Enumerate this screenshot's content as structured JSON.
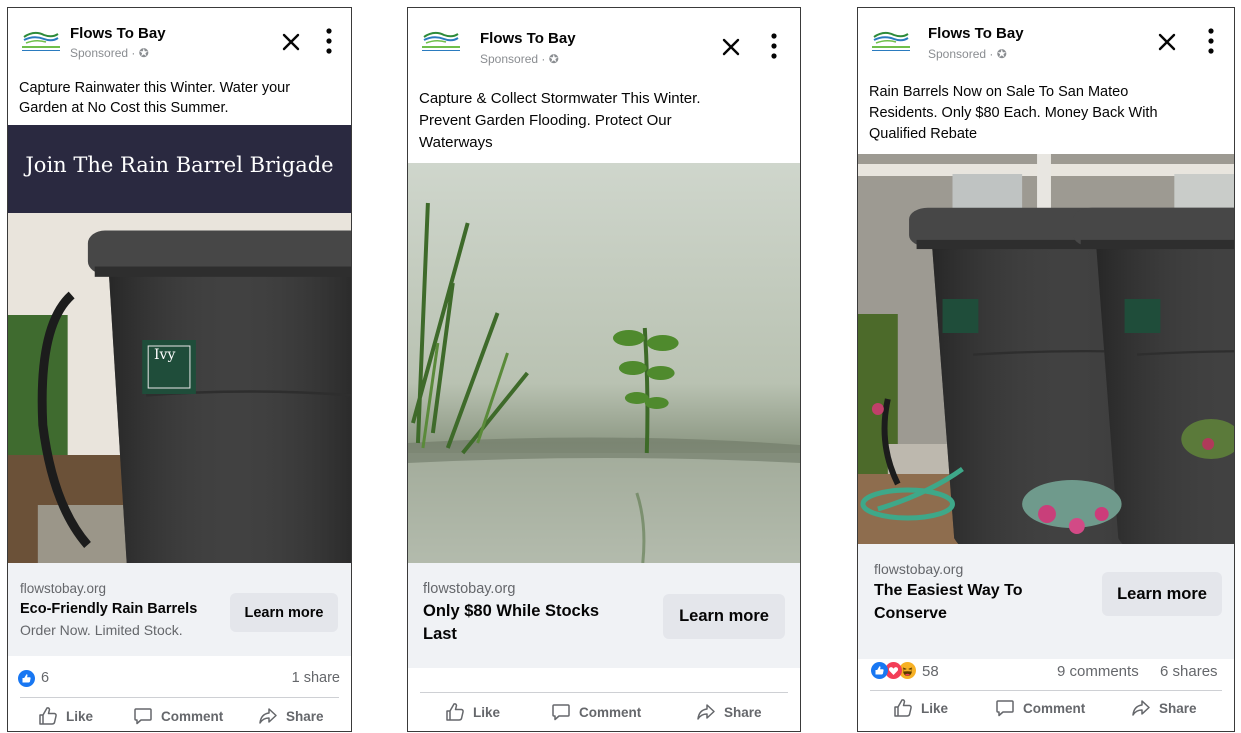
{
  "ads": [
    {
      "page_name": "Flows To Bay",
      "sponsored": "Sponsored · ✪",
      "caption": [
        "Capture Rainwater this Winter. Water your",
        "Garden at No Cost this Summer."
      ],
      "banner_text": "Join The Rain Barrel Brigade",
      "domain": "flowstobay.org",
      "headline": "Eco-Friendly Rain Barrels",
      "subline": "Order Now. Limited Stock.",
      "cta": "Learn more",
      "reaction_count": "6",
      "shares": "1 share",
      "actions": {
        "like": "Like",
        "comment": "Comment",
        "share": "Share"
      }
    },
    {
      "page_name": "Flows To Bay",
      "sponsored": "Sponsored · ✪",
      "caption": [
        "Capture & Collect Stormwater This Winter.",
        "Prevent Garden Flooding. Protect Our",
        "Waterways"
      ],
      "domain": "flowstobay.org",
      "headline": [
        "Only $80 While Stocks",
        "Last"
      ],
      "cta": "Learn more",
      "actions": {
        "like": "Like",
        "comment": "Comment",
        "share": "Share"
      }
    },
    {
      "page_name": "Flows To Bay",
      "sponsored": "Sponsored · ✪",
      "caption": [
        "Rain Barrels Now on Sale To San Mateo",
        "Residents. Only $80 Each. Money Back With",
        "Qualified Rebate"
      ],
      "domain": "flowstobay.org",
      "headline": [
        "The Easiest Way To",
        "Conserve"
      ],
      "cta": "Learn more",
      "reaction_count": "58",
      "comments": "9 comments",
      "shares": "6 shares",
      "actions": {
        "like": "Like",
        "comment": "Comment",
        "share": "Share"
      }
    }
  ],
  "logo_text": "flowstobay.org",
  "barrel_label": "Ivy",
  "colors": {
    "like_blue": "#1877f2",
    "love_red": "#f33e58",
    "haha_yellow": "#f7b125",
    "banner_bg": "#2a2940",
    "barrel": "#3a3a3a"
  }
}
